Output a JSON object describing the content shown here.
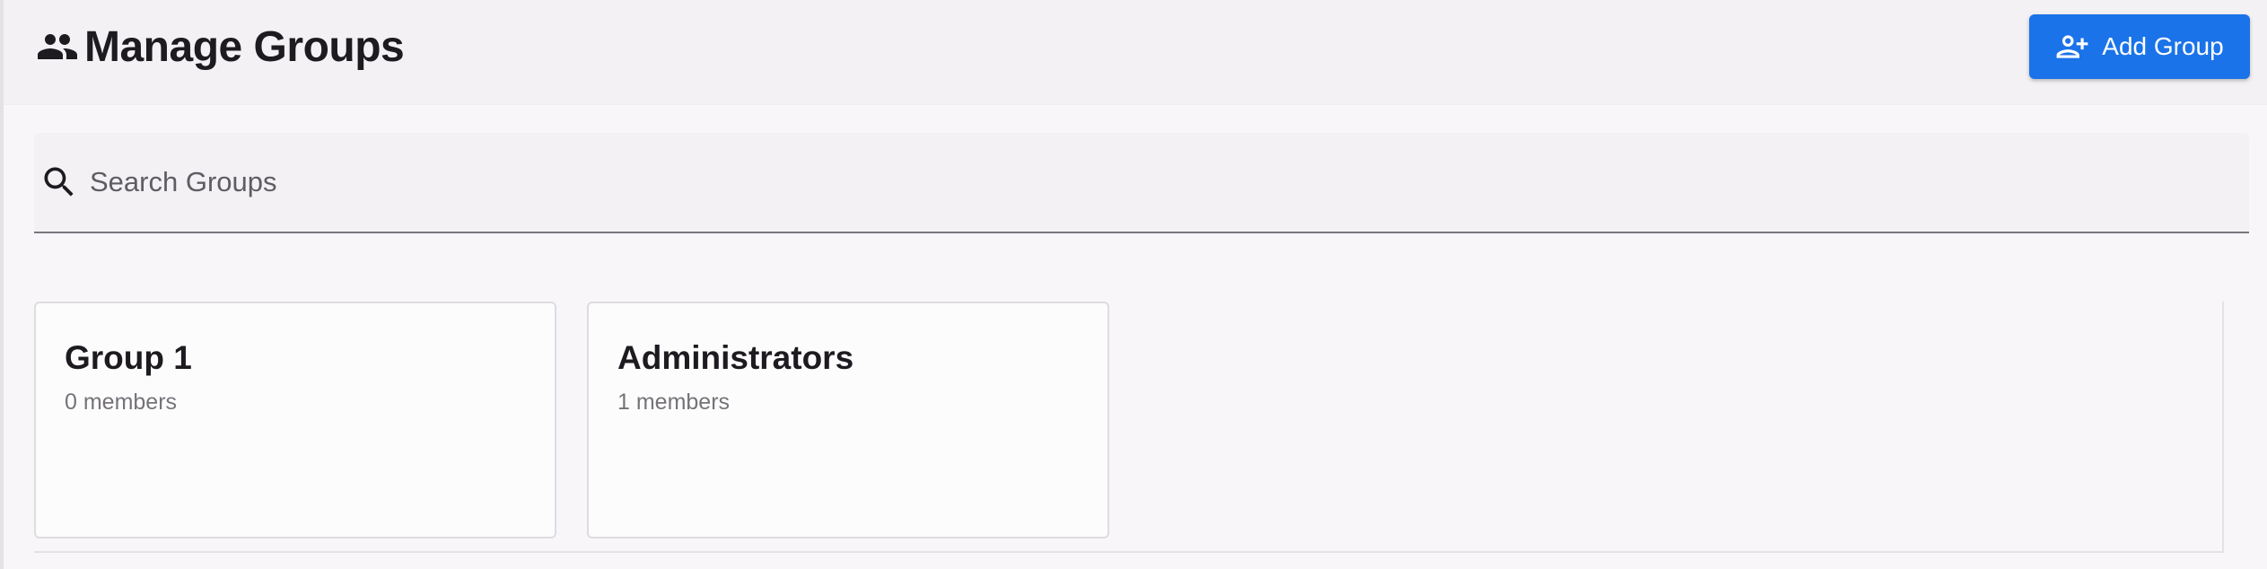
{
  "header": {
    "title": "Manage Groups",
    "title_icon": "group-icon",
    "add_button": {
      "label": "Add Group",
      "icon": "group-add-icon",
      "color": "#1a73e8"
    }
  },
  "search": {
    "placeholder": "Search Groups",
    "value": "",
    "icon": "search-icon"
  },
  "groups": [
    {
      "name": "Group 1",
      "members": "0 members"
    },
    {
      "name": "Administrators",
      "members": "1 members"
    }
  ]
}
